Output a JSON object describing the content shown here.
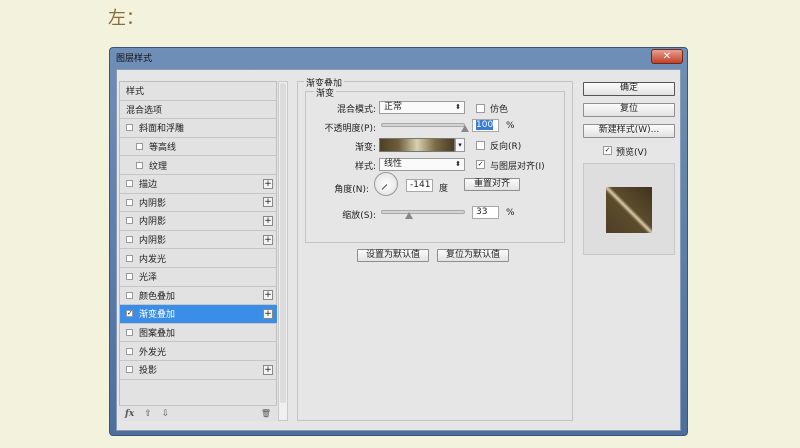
{
  "heading": "左：",
  "dialog": {
    "title": "图层样式",
    "close": "✕"
  },
  "styles_list": [
    {
      "label": "样式",
      "checkbox": false,
      "indent": 0,
      "plus": false
    },
    {
      "label": "混合选项",
      "checkbox": false,
      "indent": 0,
      "plus": false
    },
    {
      "label": "斜面和浮雕",
      "checkbox": true,
      "checked": false,
      "indent": 0,
      "plus": false
    },
    {
      "label": "等高线",
      "checkbox": true,
      "checked": false,
      "indent": 1,
      "plus": false
    },
    {
      "label": "纹理",
      "checkbox": true,
      "checked": false,
      "indent": 1,
      "plus": false
    },
    {
      "label": "描边",
      "checkbox": true,
      "checked": false,
      "indent": 0,
      "plus": true
    },
    {
      "label": "内阴影",
      "checkbox": true,
      "checked": false,
      "indent": 0,
      "plus": true
    },
    {
      "label": "内阴影",
      "checkbox": true,
      "checked": false,
      "indent": 0,
      "plus": true
    },
    {
      "label": "内阴影",
      "checkbox": true,
      "checked": false,
      "indent": 0,
      "plus": true
    },
    {
      "label": "内发光",
      "checkbox": true,
      "checked": false,
      "indent": 0,
      "plus": false
    },
    {
      "label": "光泽",
      "checkbox": true,
      "checked": false,
      "indent": 0,
      "plus": false
    },
    {
      "label": "颜色叠加",
      "checkbox": true,
      "checked": false,
      "indent": 0,
      "plus": true
    },
    {
      "label": "渐变叠加",
      "checkbox": true,
      "checked": true,
      "indent": 0,
      "plus": true,
      "selected": true
    },
    {
      "label": "图案叠加",
      "checkbox": true,
      "checked": false,
      "indent": 0,
      "plus": false
    },
    {
      "label": "外发光",
      "checkbox": true,
      "checked": false,
      "indent": 0,
      "plus": false
    },
    {
      "label": "投影",
      "checkbox": true,
      "checked": false,
      "indent": 0,
      "plus": true
    }
  ],
  "list_toolbar": {
    "fx": "fx",
    "up": "⇧",
    "down": "⇩",
    "trash": "🗑"
  },
  "panel": {
    "group_title": "渐变叠加",
    "sub_title": "渐变",
    "blend_label": "混合模式:",
    "blend_value": "正常",
    "dither_label": "仿色",
    "opacity_label": "不透明度(P):",
    "opacity_value": "100",
    "opacity_fraction": 1.0,
    "pct": "%",
    "gradient_label": "渐变:",
    "reverse_label": "反向(R)",
    "style_label": "样式:",
    "style_value": "线性",
    "align_label": "与图层对齐(I)",
    "angle_label": "角度(N):",
    "angle_value": "-141",
    "degree": "度",
    "reset_align": "重置对齐",
    "scale_label": "缩放(S):",
    "scale_value": "33",
    "scale_fraction": 0.33,
    "set_default": "设置为默认值",
    "reset_default": "复位为默认值"
  },
  "right": {
    "ok": "确定",
    "reset": "复位",
    "new_style": "新建样式(W)...",
    "preview_label": "预览(V)"
  }
}
